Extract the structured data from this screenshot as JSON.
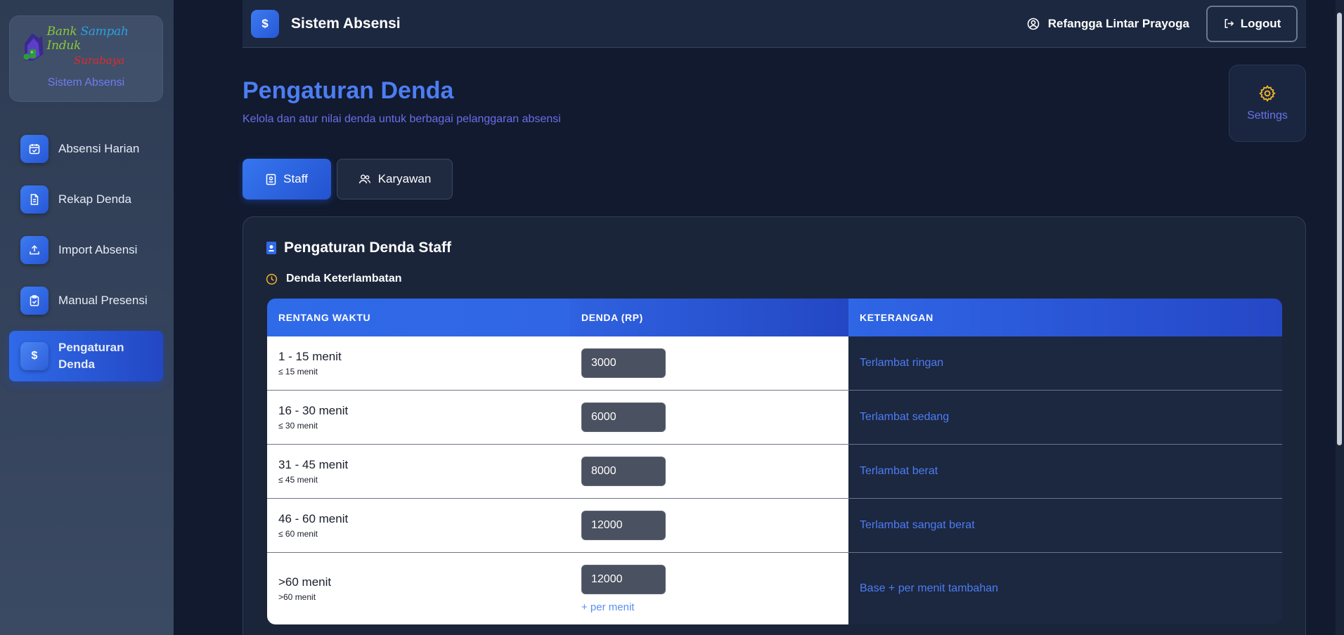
{
  "sidebar": {
    "logo": {
      "line1_a": "Bank ",
      "line1_b": "Sampah",
      "line1_c": " Induk",
      "line2": "Surabaya"
    },
    "subtitle": "Sistem Absensi",
    "items": [
      {
        "label": "Absensi Harian",
        "icon": "calendar-check-icon"
      },
      {
        "label": "Rekap Denda",
        "icon": "document-icon"
      },
      {
        "label": "Import Absensi",
        "icon": "upload-icon"
      },
      {
        "label": "Manual Presensi",
        "icon": "clipboard-check-icon"
      },
      {
        "label": "Pengaturan Denda",
        "icon": "dollar-icon",
        "active": true
      }
    ]
  },
  "topbar": {
    "logo_symbol": "$",
    "title": "Sistem Absensi",
    "user_name": "Refangga Lintar Prayoga",
    "logout_label": "Logout"
  },
  "page": {
    "title": "Pengaturan Denda",
    "subtitle": "Kelola dan atur nilai denda untuk berbagai pelanggaran absensi",
    "settings_label": "Settings"
  },
  "tabs": [
    {
      "label": "Staff",
      "active": true
    },
    {
      "label": "Karyawan",
      "active": false
    }
  ],
  "panel": {
    "title": "Pengaturan Denda Staff",
    "section_title": "Denda Keterlambatan",
    "table": {
      "headers": [
        "RENTANG WAKTU",
        "DENDA (RP)",
        "KETERANGAN"
      ],
      "rows": [
        {
          "range": "1 - 15 menit",
          "sub": "≤ 15 menit",
          "value": "3000",
          "note": "Terlambat ringan"
        },
        {
          "range": "16 - 30 menit",
          "sub": "≤ 30 menit",
          "value": "6000",
          "note": "Terlambat sedang"
        },
        {
          "range": "31 - 45 menit",
          "sub": "≤ 45 menit",
          "value": "8000",
          "note": "Terlambat berat"
        },
        {
          "range": "46 - 60 menit",
          "sub": "≤ 60 menit",
          "value": "12000",
          "note": "Terlambat sangat berat"
        },
        {
          "range": ">60 menit",
          "sub": ">60 menit",
          "value": "12000",
          "extra": "+ per menit",
          "note": "Base + per menit tambahan"
        }
      ]
    }
  },
  "colors": {
    "accent": "#2f6ae8",
    "title_blue": "#4d7df2",
    "settings_gold": "#f0b429",
    "clock_gold": "#f0b429"
  }
}
